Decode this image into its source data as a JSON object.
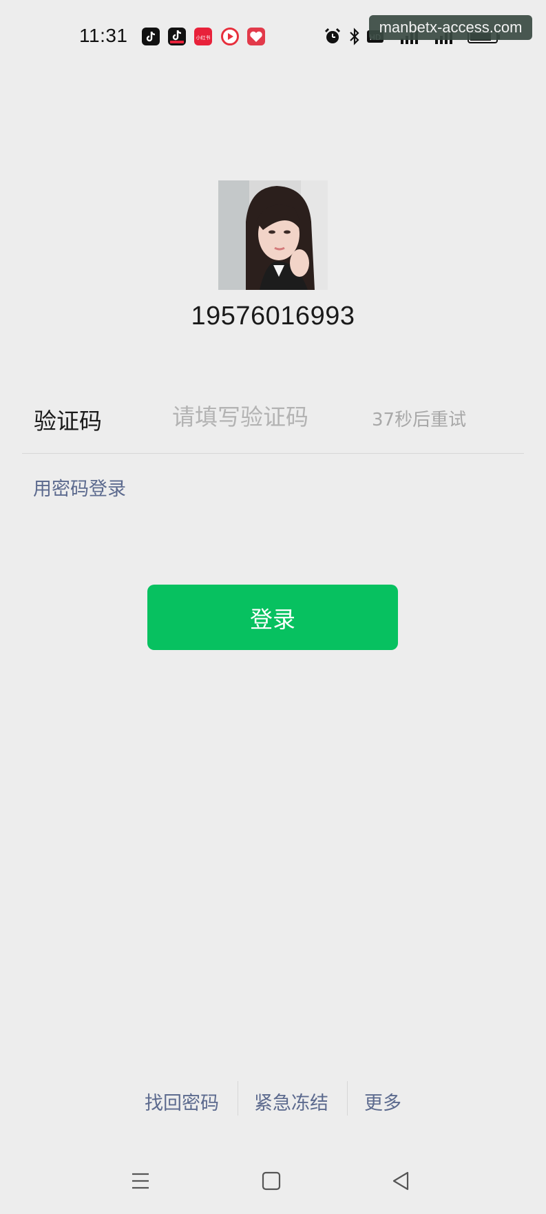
{
  "status_bar": {
    "time": "11:31",
    "app_icons": [
      "tiktok-icon",
      "tiktok-lite-icon",
      "xiaohongshu-icon",
      "video-app-icon",
      "shopping-app-icon"
    ],
    "xhs_text": "小红书",
    "system_icons": [
      "alarm-icon",
      "bluetooth-icon",
      "hd-icon",
      "signal-icon",
      "signal-icon",
      "battery-icon"
    ],
    "hd_text": "HD"
  },
  "watermark": "manbetx-access.com",
  "account": {
    "phone": "19576016993"
  },
  "verification": {
    "label": "验证码",
    "placeholder": "请填写验证码",
    "retry": "37秒后重试"
  },
  "password_login": "用密码登录",
  "login_button": "登录",
  "bottom_links": [
    "找回密码",
    "紧急冻结",
    "更多"
  ],
  "nav": [
    "menu-icon",
    "home-icon",
    "back-icon"
  ],
  "colors": {
    "background": "#ededed",
    "primary_green": "#07c160",
    "link_blue": "#5c6a8e"
  }
}
